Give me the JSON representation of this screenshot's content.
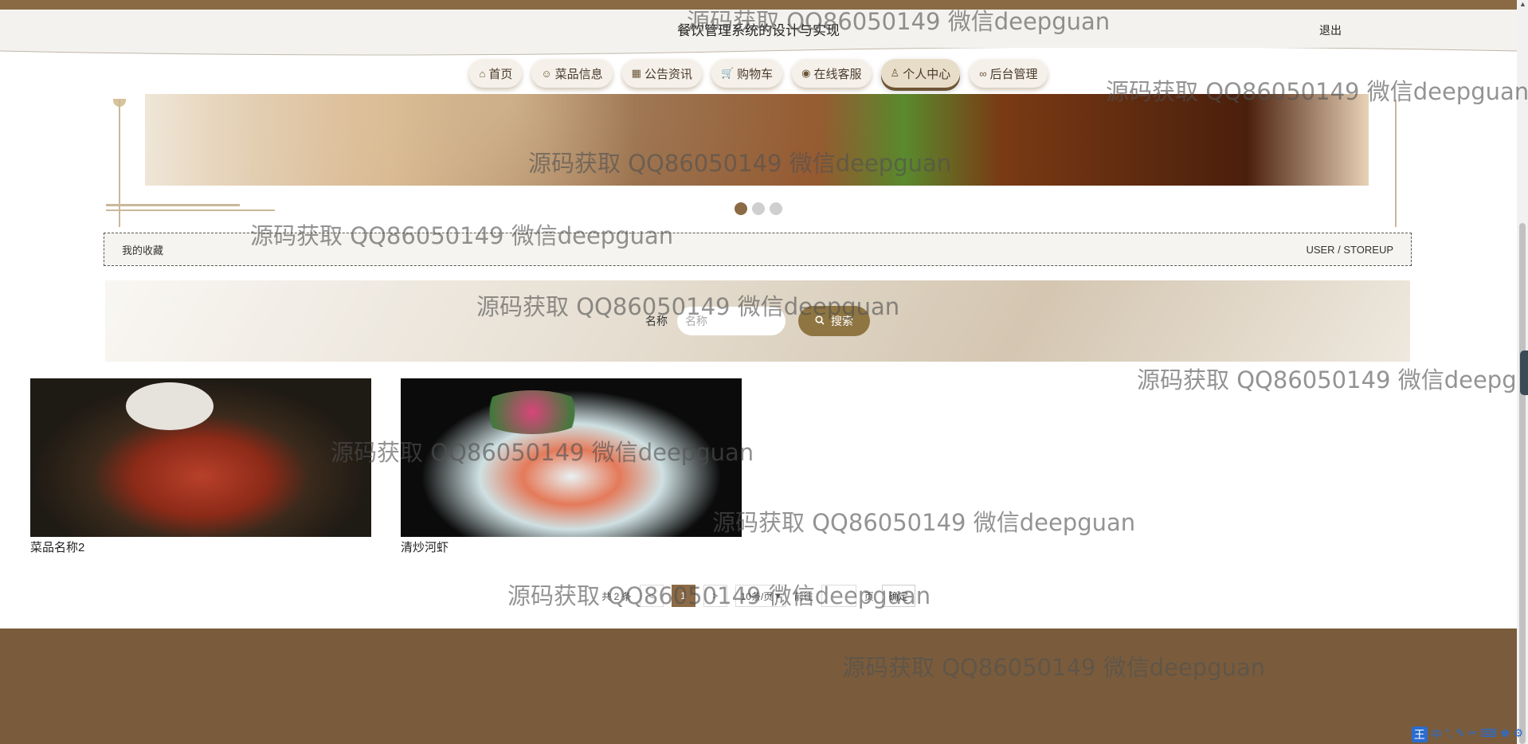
{
  "header": {
    "title": "餐饮管理系统的设计与实现",
    "logout_label": "退出"
  },
  "nav": {
    "items": [
      {
        "label": "首页",
        "icon": "home-icon",
        "glyph": "⌂"
      },
      {
        "label": "菜品信息",
        "icon": "dish-icon",
        "glyph": "☺"
      },
      {
        "label": "公告资讯",
        "icon": "news-icon",
        "glyph": "▦"
      },
      {
        "label": "购物车",
        "icon": "cart-icon",
        "glyph": "🛒"
      },
      {
        "label": "在线客服",
        "icon": "chat-icon",
        "glyph": "◉"
      },
      {
        "label": "个人中心",
        "icon": "user-icon",
        "glyph": "♙"
      },
      {
        "label": "后台管理",
        "icon": "link-icon",
        "glyph": "∞"
      }
    ],
    "active_index": 5
  },
  "carousel": {
    "slide_count": 3,
    "active_index": 0
  },
  "breadcrumb": {
    "title": "我的收藏",
    "path": "USER / STOREUP"
  },
  "search": {
    "label": "名称",
    "placeholder": "名称",
    "button_label": "搜索"
  },
  "items": [
    {
      "name": "菜品名称2"
    },
    {
      "name": "清炒河虾"
    }
  ],
  "pagination": {
    "total": "共 2 条",
    "prev": "<",
    "current_page": "1",
    "next": ">",
    "page_size": "10条/页",
    "goto_label": "前往",
    "page_suffix": "页",
    "confirm_label": "确定"
  },
  "watermark": "源码获取 QQ86050149 微信deepguan",
  "ime": {
    "logo": "王",
    "mode": "中"
  },
  "colors": {
    "brand_brown": "#8b6a45",
    "footer_brown": "#7a5c3c",
    "button_gold": "#8f7541"
  }
}
